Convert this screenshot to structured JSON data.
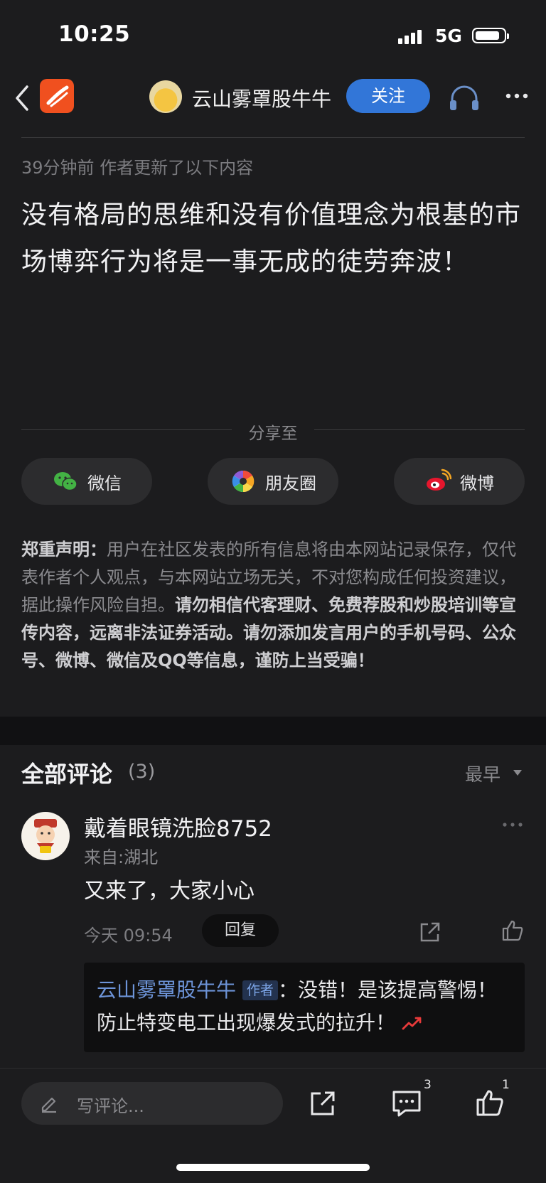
{
  "status": {
    "time": "10:25",
    "network": "5G"
  },
  "nav": {
    "title": "云山雾罩股牛牛",
    "follow_label": "关注"
  },
  "post": {
    "updated": "39分钟前 作者更新了以下内容",
    "body": "没有格局的思维和没有价值理念为根基的市场博弈行为将是一事无成的徒劳奔波！"
  },
  "share": {
    "label": "分享至",
    "targets": [
      {
        "label": "微信",
        "icon": "wechat-icon"
      },
      {
        "label": "朋友圈",
        "icon": "moments-icon"
      },
      {
        "label": "微博",
        "icon": "weibo-icon"
      }
    ]
  },
  "disclaimer": {
    "heading": "郑重声明：",
    "normal": "用户在社区发表的所有信息将由本网站记录保存，仅代表作者个人观点，与本网站立场无关，不对您构成任何投资建议，据此操作风险自担。",
    "bold": "请勿相信代客理财、免费荐股和炒股培训等宣传内容，远离非法证券活动。请勿添加发言用户的手机号码、公众号、微博、微信及QQ等信息，谨防上当受骗！"
  },
  "comments": {
    "title": "全部评论",
    "count": "(3)",
    "sort": "最早",
    "items": [
      {
        "user": "戴着眼镜洗脸8752",
        "location": "来自:湖北",
        "text": "又来了，大家小心",
        "time": "今天 09:54",
        "reply_label": "回复",
        "reply": {
          "author": "云山雾罩股牛牛",
          "tag": "作者",
          "text": "：没错！是该提高警惕！防止特变电工出现爆发式的拉升！"
        }
      }
    ]
  },
  "bottom": {
    "placeholder": "写评论...",
    "comment_count": "3",
    "like_count": "1"
  },
  "colors": {
    "accent": "#3276d8",
    "background": "#1c1c1e",
    "app_logo": "#f0501f"
  }
}
